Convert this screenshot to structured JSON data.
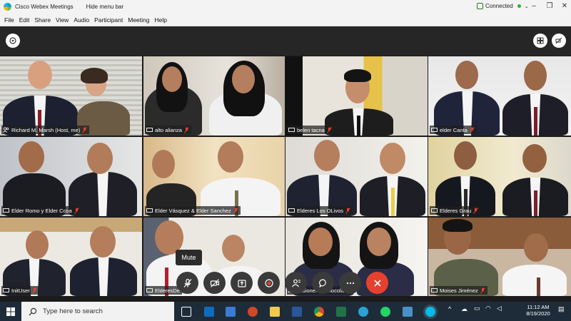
{
  "titlebar": {
    "app_title": "Cisco Webex Meetings",
    "hide_menu_label": "Hide menu bar",
    "status": "Connected"
  },
  "menu": [
    "File",
    "Edit",
    "Share",
    "View",
    "Audio",
    "Participant",
    "Meeting",
    "Help"
  ],
  "tiles": [
    {
      "name": "Richard M. Marsh (Host, me)"
    },
    {
      "name": "alto alianza"
    },
    {
      "name": "belen tacna"
    },
    {
      "name": "elder Canta"
    },
    {
      "name": "Elder Romo y Elder Ccoa"
    },
    {
      "name": "Elder Vásquez & Elder Sanchez"
    },
    {
      "name": "Elderes Los OLivos"
    },
    {
      "name": "Elderes Grau"
    },
    {
      "name": "InitUser"
    },
    {
      "name": "ElderesDe"
    },
    {
      "name": "Misioneras Chocolates"
    },
    {
      "name": "Moises Jiménez"
    }
  ],
  "tooltip": "Mute",
  "taskbar": {
    "search_placeholder": "Type here to search",
    "time": "11:12 AM",
    "date": "8/19/2020"
  },
  "colors": {
    "accent": "#2fb3e8",
    "end_call": "#e6412f",
    "mic_muted": "#e6412f"
  }
}
